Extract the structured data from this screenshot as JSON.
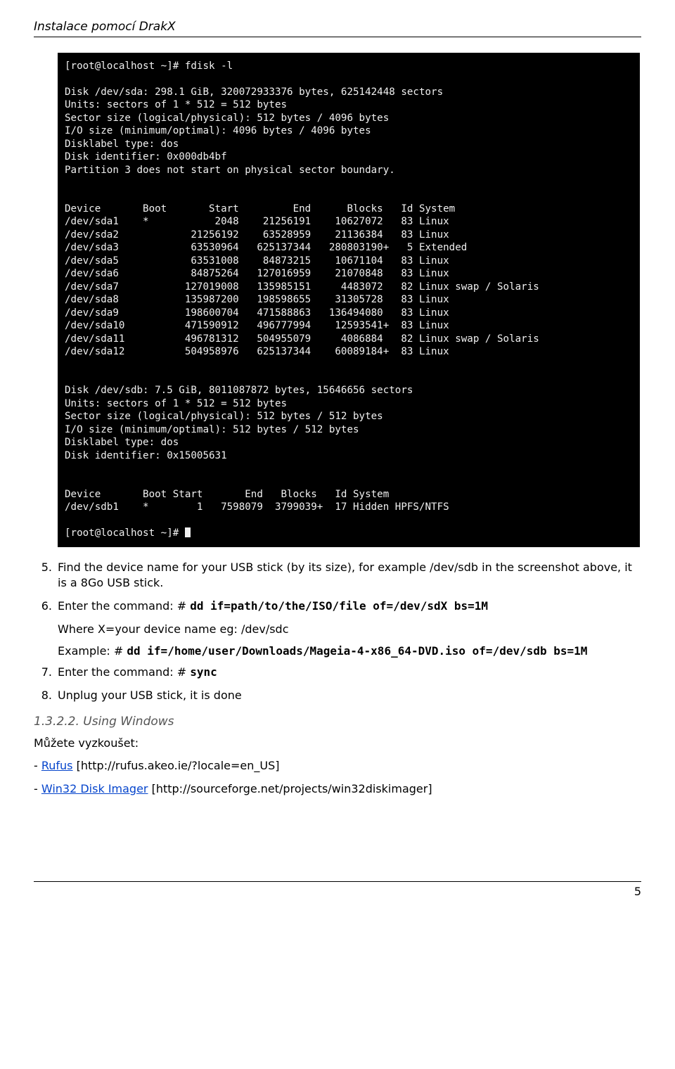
{
  "header": {
    "title": "Instalace pomocí DrakX"
  },
  "terminal": {
    "lines": [
      "[root@localhost ~]# fdisk -l",
      "",
      "Disk /dev/sda: 298.1 GiB, 320072933376 bytes, 625142448 sectors",
      "Units: sectors of 1 * 512 = 512 bytes",
      "Sector size (logical/physical): 512 bytes / 4096 bytes",
      "I/O size (minimum/optimal): 4096 bytes / 4096 bytes",
      "Disklabel type: dos",
      "Disk identifier: 0x000db4bf",
      "Partition 3 does not start on physical sector boundary.",
      "",
      "",
      "Device       Boot       Start         End      Blocks   Id System",
      "/dev/sda1    *           2048    21256191    10627072   83 Linux",
      "/dev/sda2            21256192    63528959    21136384   83 Linux",
      "/dev/sda3            63530964   625137344   280803190+   5 Extended",
      "/dev/sda5            63531008    84873215    10671104   83 Linux",
      "/dev/sda6            84875264   127016959    21070848   83 Linux",
      "/dev/sda7           127019008   135985151     4483072   82 Linux swap / Solaris",
      "/dev/sda8           135987200   198598655    31305728   83 Linux",
      "/dev/sda9           198600704   471588863   136494080   83 Linux",
      "/dev/sda10          471590912   496777994    12593541+  83 Linux",
      "/dev/sda11          496781312   504955079     4086884   82 Linux swap / Solaris",
      "/dev/sda12          504958976   625137344    60089184+  83 Linux",
      "",
      "",
      "Disk /dev/sdb: 7.5 GiB, 8011087872 bytes, 15646656 sectors",
      "Units: sectors of 1 * 512 = 512 bytes",
      "Sector size (logical/physical): 512 bytes / 512 bytes",
      "I/O size (minimum/optimal): 512 bytes / 512 bytes",
      "Disklabel type: dos",
      "Disk identifier: 0x15005631",
      "",
      "",
      "Device       Boot Start       End   Blocks   Id System",
      "/dev/sdb1    *        1   7598079  3799039+  17 Hidden HPFS/NTFS",
      "",
      "[root@localhost ~]# "
    ]
  },
  "steps": {
    "s5": {
      "num": "5.",
      "text": "Find the device name for your USB stick (by its size), for example /dev/sdb in the screenshot above, it is a 8Go USB stick."
    },
    "s6": {
      "num": "6.",
      "text_prefix": "Enter the command: # ",
      "cmd": "dd if=path/to/the/ISO/file of=/dev/sdX bs=1M",
      "where": "Where X=your device name eg: /dev/sdc",
      "example_prefix": "Example: # ",
      "example_cmd": "dd if=/home/user/Downloads/Mageia-4-x86_64-DVD.iso of=/dev/sdb bs=1M"
    },
    "s7": {
      "num": "7.",
      "text_prefix": "Enter the command: # ",
      "cmd": "sync"
    },
    "s8": {
      "num": "8.",
      "text": "Unplug your USB stick, it is done"
    }
  },
  "section": {
    "heading": "1.3.2.2. Using Windows",
    "try_text": "Můžete vyzkoušet:",
    "rufus_dash": "- ",
    "rufus_label": "Rufus",
    "rufus_url": " [http://rufus.akeo.ie/?locale=en_US]",
    "win32_dash": "- ",
    "win32_label": "Win32 Disk Imager",
    "win32_url": " [http://sourceforge.net/projects/win32diskimager]"
  },
  "footer": {
    "page": "5"
  }
}
